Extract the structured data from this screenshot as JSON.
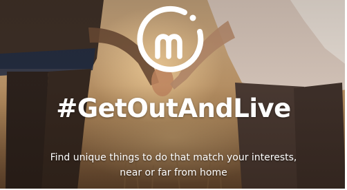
{
  "hero": {
    "headline": "#GetOutAndLive",
    "tagline_line1": "Find unique things to do that match your interests,",
    "tagline_line2": "near or far from home"
  },
  "logo": {
    "letter": "m",
    "icon": "meetup-style-m-circle-icon",
    "color": "#ffffff"
  },
  "colors": {
    "text": "#ffffff",
    "photo_tone": "#b58d5f"
  }
}
